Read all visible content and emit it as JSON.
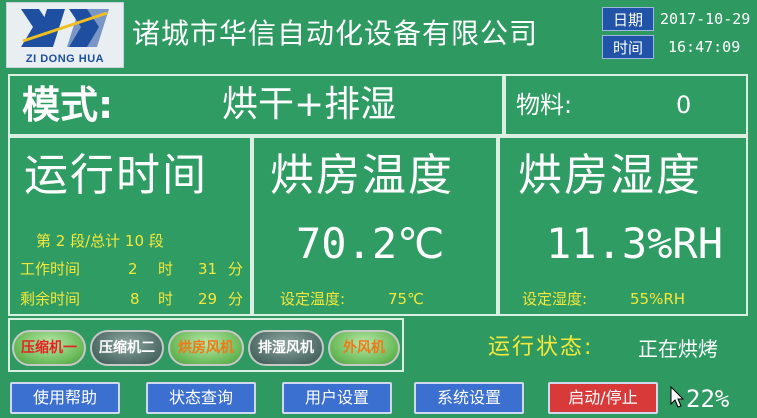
{
  "header": {
    "logo_text": "ZI DONG HUA",
    "company": "诸城市华信自动化设备有限公司",
    "date_label": "日期",
    "date_value": "2017-10-29",
    "time_label": "时间",
    "time_value": "16:47:09"
  },
  "mode": {
    "label": "模式:",
    "value": "烘干+排湿",
    "material_label": "物料:",
    "material_value": "0"
  },
  "runtime": {
    "title": "运行时间",
    "stage_line": "第 2 段/总计 10 段",
    "work_label": "工作时间",
    "work_hours": "2",
    "work_minutes": "31",
    "remain_label": "剩余时间",
    "remain_hours": "8",
    "remain_minutes": "29",
    "hour_unit": "时",
    "minute_unit": "分"
  },
  "temperature": {
    "title": "烘房温度",
    "value": "70.2℃",
    "setpoint_label": "设定温度:",
    "setpoint_value": "75℃"
  },
  "humidity": {
    "title": "烘房湿度",
    "value": "11.3%RH",
    "setpoint_label": "设定湿度:",
    "setpoint_value": "55%RH"
  },
  "devices": [
    {
      "label": "压缩机一",
      "state": "on",
      "text_color": "#e62222"
    },
    {
      "label": "压缩机二",
      "state": "off",
      "text_color": "#ffffff"
    },
    {
      "label": "烘房风机",
      "state": "on",
      "text_color": "#f07818"
    },
    {
      "label": "排湿风机",
      "state": "off",
      "text_color": "#ffffff"
    },
    {
      "label": "外风机",
      "state": "on",
      "text_color": "#f07818"
    }
  ],
  "run_status": {
    "label": "运行状态:",
    "value": "正在烘烤"
  },
  "buttons": {
    "help": "使用帮助",
    "status_query": "状态查询",
    "user_settings": "用户设置",
    "system_settings": "系统设置",
    "start_stop": "启动/停止"
  },
  "progress_percent": "22%",
  "colors": {
    "background": "#2e9a62",
    "button_blue": "#3b6fd0",
    "button_red": "#d83a3a",
    "highlight_yellow": "#f5e83a"
  }
}
